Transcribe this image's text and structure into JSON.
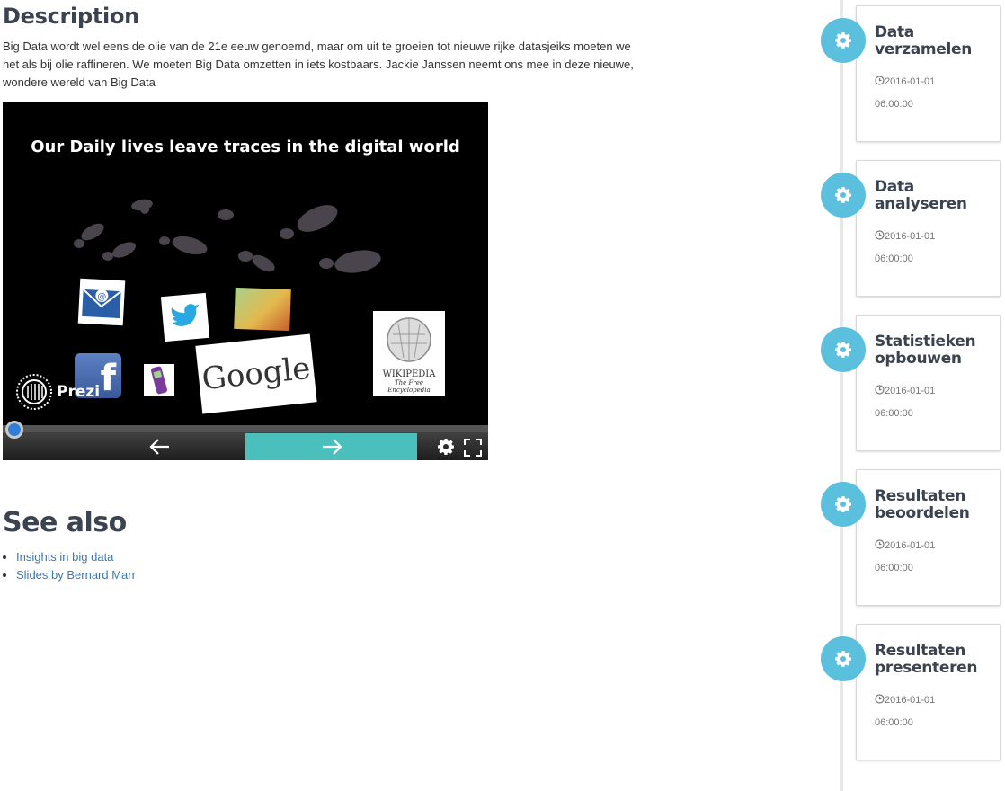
{
  "description": {
    "title": "Description",
    "text": "Big Data wordt wel eens de olie van de 21e eeuw genoemd, maar om uit te groeien tot nieuwe rijke datasjeiks moeten we net als bij olie raffineren. We moeten Big Data omzetten in iets kostbaars. Jackie Janssen neemt ons mee in deze nieuwe, wondere wereld van Big Data"
  },
  "prezi": {
    "slide_title": "Our Daily lives leave traces in the digital world",
    "logo_text": "Prezi",
    "google_text": "Google",
    "wikipedia_title": "WIKIPEDIA",
    "wikipedia_sub": "The Free Encyclopedia",
    "progress_fraction": 0.0,
    "controls": {
      "prev_icon": "arrow-left-icon",
      "next_icon": "arrow-right-icon",
      "settings_icon": "gear-icon",
      "fullscreen_icon": "fullscreen-icon"
    },
    "accent_color": "#4bbfbc"
  },
  "see_also": {
    "title": "See also",
    "links": [
      {
        "label": "Insights in big data"
      },
      {
        "label": "Slides by Bernard Marr"
      }
    ]
  },
  "timeline": {
    "accent_color": "#5bc0de",
    "steps": [
      {
        "title": "Data verzamelen",
        "date": "2016-01-01",
        "time": "06:00:00",
        "icon": "gear-icon"
      },
      {
        "title": "Data analyseren",
        "date": "2016-01-01",
        "time": "06:00:00",
        "icon": "gear-icon"
      },
      {
        "title": "Statistieken opbouwen",
        "date": "2016-01-01",
        "time": "06:00:00",
        "icon": "gear-icon"
      },
      {
        "title": "Resultaten beoordelen",
        "date": "2016-01-01",
        "time": "06:00:00",
        "icon": "gear-icon"
      },
      {
        "title": "Resultaten presenteren",
        "date": "2016-01-01",
        "time": "06:00:00",
        "icon": "gear-icon"
      }
    ]
  }
}
